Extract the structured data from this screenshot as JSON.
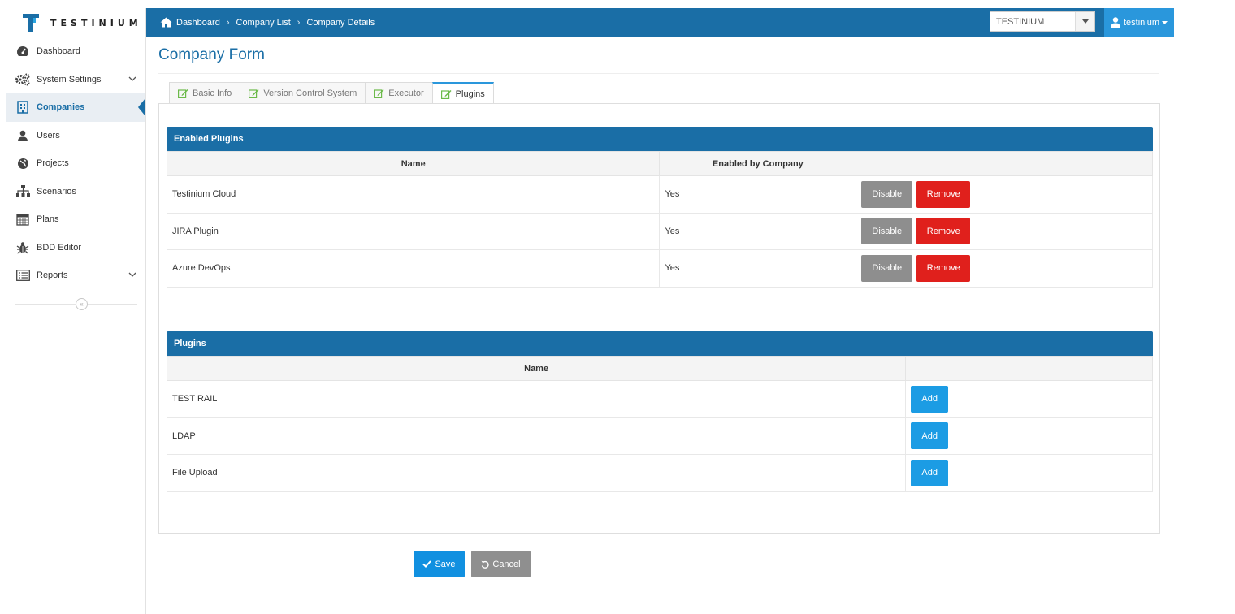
{
  "app": {
    "logo_text": "TESTINIUM"
  },
  "sidebar": {
    "items": [
      {
        "label": "Dashboard",
        "icon": "dashboard-icon"
      },
      {
        "label": "System Settings",
        "icon": "cogs-icon",
        "has_submenu": true
      },
      {
        "label": "Companies",
        "icon": "building-icon",
        "active": true
      },
      {
        "label": "Users",
        "icon": "user-icon"
      },
      {
        "label": "Projects",
        "icon": "globe-icon"
      },
      {
        "label": "Scenarios",
        "icon": "sitemap-icon"
      },
      {
        "label": "Plans",
        "icon": "calendar-icon"
      },
      {
        "label": "BDD Editor",
        "icon": "bug-icon"
      },
      {
        "label": "Reports",
        "icon": "list-icon",
        "has_submenu": true
      }
    ],
    "collapse_glyph": "«"
  },
  "topbar": {
    "breadcrumbs": [
      "Dashboard",
      "Company List",
      "Company Details"
    ],
    "company_select": {
      "value": "TESTINIUM"
    },
    "user": {
      "name": "testinium"
    }
  },
  "page": {
    "title": "Company Form"
  },
  "tabs": [
    {
      "label": "Basic Info"
    },
    {
      "label": "Version Control System"
    },
    {
      "label": "Executor"
    },
    {
      "label": "Plugins",
      "active": true
    }
  ],
  "enabled_plugins": {
    "title": "Enabled Plugins",
    "columns": [
      "Name",
      "Enabled by Company",
      ""
    ],
    "rows": [
      {
        "name": "Testinium Cloud",
        "enabled": "Yes"
      },
      {
        "name": "JIRA Plugin",
        "enabled": "Yes"
      },
      {
        "name": "Azure DevOps",
        "enabled": "Yes"
      }
    ],
    "disable_label": "Disable",
    "remove_label": "Remove"
  },
  "plugins": {
    "title": "Plugins",
    "columns": [
      "Name",
      ""
    ],
    "rows": [
      {
        "name": "TEST RAIL"
      },
      {
        "name": "LDAP"
      },
      {
        "name": "File Upload"
      }
    ],
    "add_label": "Add"
  },
  "footer": {
    "save_label": "Save",
    "cancel_label": "Cancel"
  },
  "colors": {
    "primary": "#1a6ea6",
    "accent": "#2a97dc",
    "danger": "#e0201c",
    "neutral": "#8e8e8e"
  }
}
